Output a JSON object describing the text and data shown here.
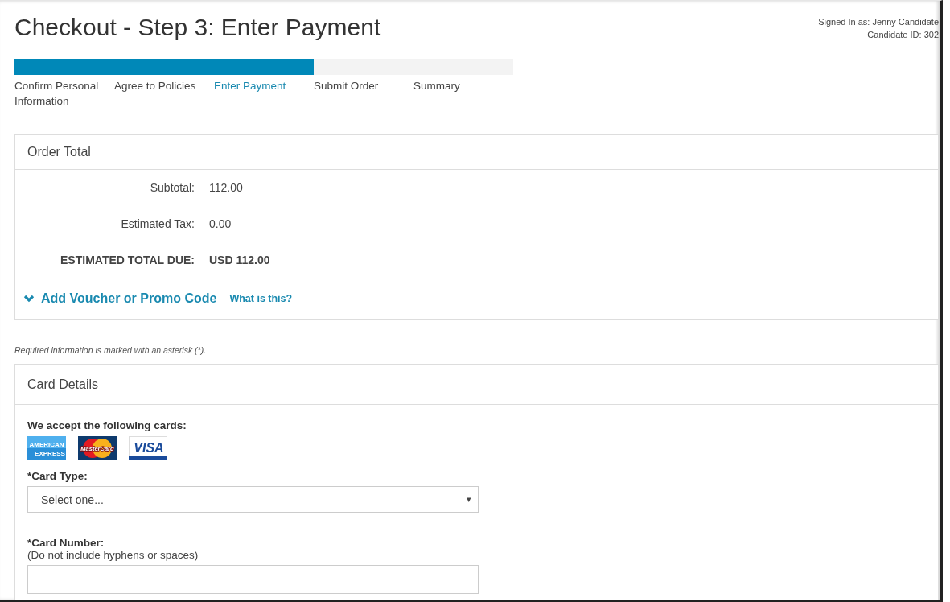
{
  "title": "Checkout - Step 3: Enter Payment",
  "user": {
    "signed_in": "Signed In as: Jenny Candidate",
    "candidate_id": "Candidate ID: 302"
  },
  "progress": {
    "level": 0.6
  },
  "steps": [
    {
      "label": "Confirm Personal Information",
      "selected": false
    },
    {
      "label": "Agree to Policies",
      "selected": false
    },
    {
      "label": "Enter Payment",
      "selected": true
    },
    {
      "label": "Submit Order",
      "selected": false
    },
    {
      "label": "Summary",
      "selected": false
    }
  ],
  "order_total": {
    "heading": "Order Total",
    "rows": [
      {
        "label": "Subtotal:",
        "value": "112.00",
        "kind": "normal"
      },
      {
        "label": "Estimated Tax:",
        "value": "0.00",
        "kind": "normal"
      },
      {
        "label": "ESTIMATED TOTAL DUE:",
        "value": "USD 112.00",
        "kind": "total"
      }
    ],
    "voucher": {
      "label": "Add Voucher or Promo Code",
      "expanded": false,
      "help": "What is this?"
    }
  },
  "required_note": "Required information is marked with an asterisk (*).",
  "card_details": {
    "heading": "Card Details",
    "accept_label": "We accept the following cards:",
    "cards": [
      {
        "kind": "amex",
        "lines": [
          "AMERICAN",
          "EXPRESS"
        ]
      },
      {
        "kind": "mastercard",
        "lines": [
          "MasterCard"
        ]
      },
      {
        "kind": "visa",
        "lines": [
          "VISA"
        ]
      }
    ],
    "card_type": {
      "label": "*Card Type:",
      "placeholder": "Select one...",
      "caret": "▾"
    },
    "card_number": {
      "label": "*Card Number:",
      "hint": "(Do not include hyphens or spaces)"
    }
  }
}
